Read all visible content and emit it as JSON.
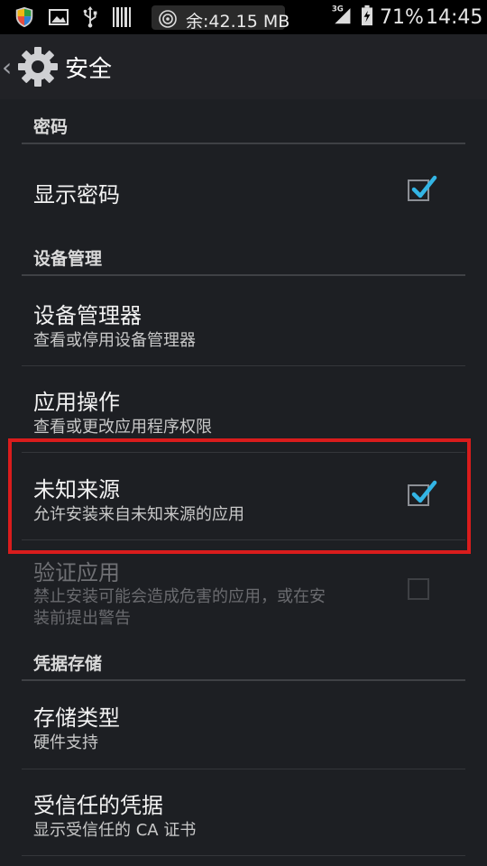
{
  "status_bar": {
    "memory": "余:42.15 MB",
    "network": "3G",
    "battery": "71%",
    "time": "14:45",
    "icons": [
      "shield-icon",
      "image-icon",
      "usb-icon",
      "barcode-icon",
      "hotspot-icon",
      "signal-icon",
      "battery-icon"
    ]
  },
  "header": {
    "title": "安全",
    "icon": "gear-icon"
  },
  "sections": {
    "password": {
      "header": "密码",
      "show_password": {
        "title": "显示密码",
        "checked": true
      }
    },
    "device_admin": {
      "header": "设备管理",
      "device_admins": {
        "title": "设备管理器",
        "summary": "查看或停用设备管理器"
      },
      "app_ops": {
        "title": "应用操作",
        "summary": "查看或更改应用程序权限"
      },
      "unknown_sources": {
        "title": "未知来源",
        "summary": "允许安装来自未知来源的应用",
        "checked": true
      },
      "verify_apps": {
        "title": "验证应用",
        "summary_line1": "禁止安装可能会造成危害的应用，或在安",
        "summary_line2": "装前提出警告",
        "checked": false,
        "enabled": false
      }
    },
    "credential_storage": {
      "header": "凭据存储",
      "storage_type": {
        "title": "存储类型",
        "summary": "硬件支持"
      },
      "trusted_credentials": {
        "title": "受信任的凭据",
        "summary": "显示受信任的 CA 证书"
      }
    }
  },
  "colors": {
    "accent": "#33b5e5",
    "highlight": "#d91c1c",
    "background": "#1d1f23",
    "action_bar": "#212226"
  }
}
